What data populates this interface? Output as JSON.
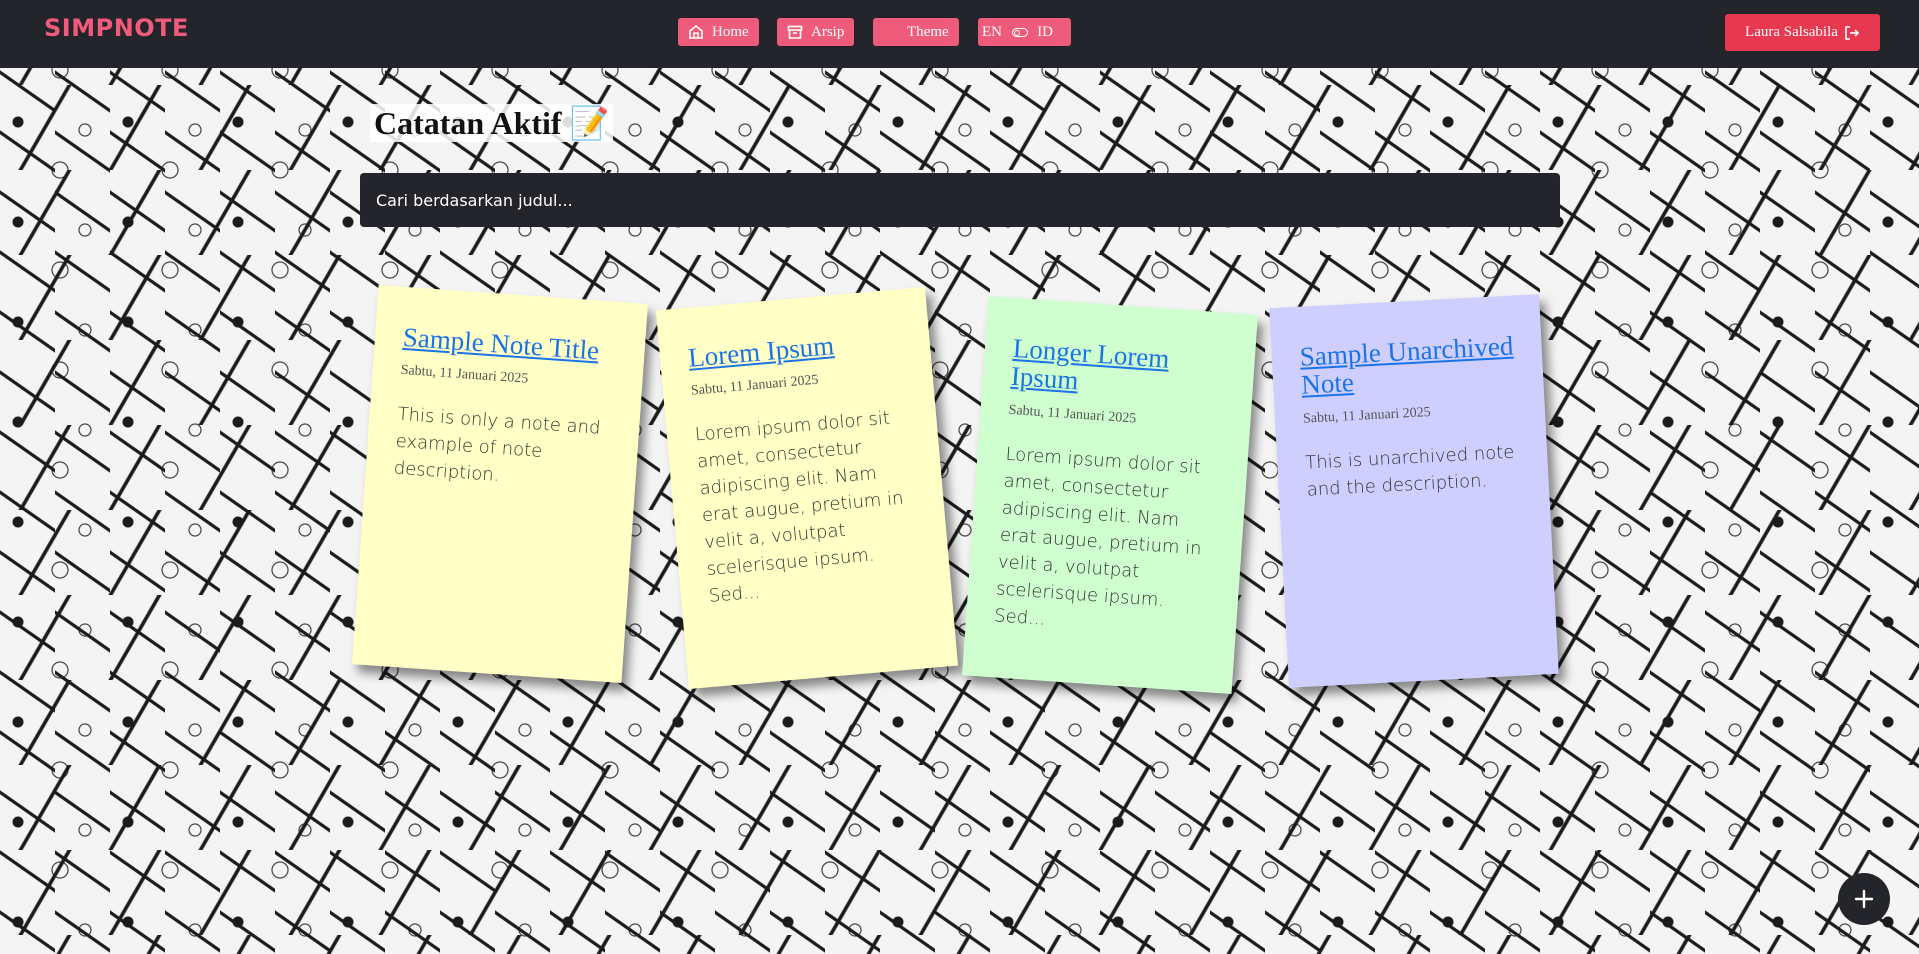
{
  "app": {
    "logo": "SIMPNOTE"
  },
  "nav": {
    "home_label": "Home",
    "archive_label": "Arsip",
    "theme_label": "Theme",
    "lang_en": "EN",
    "lang_id": "ID",
    "user_label": "Laura Salsabila"
  },
  "page": {
    "title": "Catatan Aktif 📝",
    "search_placeholder": "Cari berdasarkan judul..."
  },
  "notes": [
    {
      "title": "Sample Note Title",
      "date": "Sabtu, 11 Januari 2025",
      "body": "This is only a note and example of note description.",
      "color": "#ffffc6"
    },
    {
      "title": "Lorem Ipsum",
      "date": "Sabtu, 11 Januari 2025",
      "body": "Lorem ipsum dolor sit amet, consectetur adipiscing elit. Nam erat augue, pretium in velit a, volutpat scelerisque ipsum. Sed...",
      "color": "#ffffc6"
    },
    {
      "title": "Longer Lorem Ipsum",
      "date": "Sabtu, 11 Januari 2025",
      "body": "Lorem ipsum dolor sit amet, consectetur adipiscing elit. Nam erat augue, pretium in velit a, volutpat scelerisque ipsum. Sed...",
      "color": "#cfffce"
    },
    {
      "title": "Sample Unarchived Note",
      "date": "Sabtu, 11 Januari 2025",
      "body": "This is unarchived note and the description.",
      "color": "#cfcfff"
    }
  ],
  "colors": {
    "navbar": "#24252a",
    "accent": "#ef5b7a",
    "logout": "#e8384f",
    "link": "#1a73e8"
  },
  "icons": {
    "home": "home-icon",
    "archive": "archive-icon",
    "theme": "moon-icon",
    "toggle": "toggle-icon",
    "logout": "logout-icon",
    "add": "plus-icon"
  }
}
